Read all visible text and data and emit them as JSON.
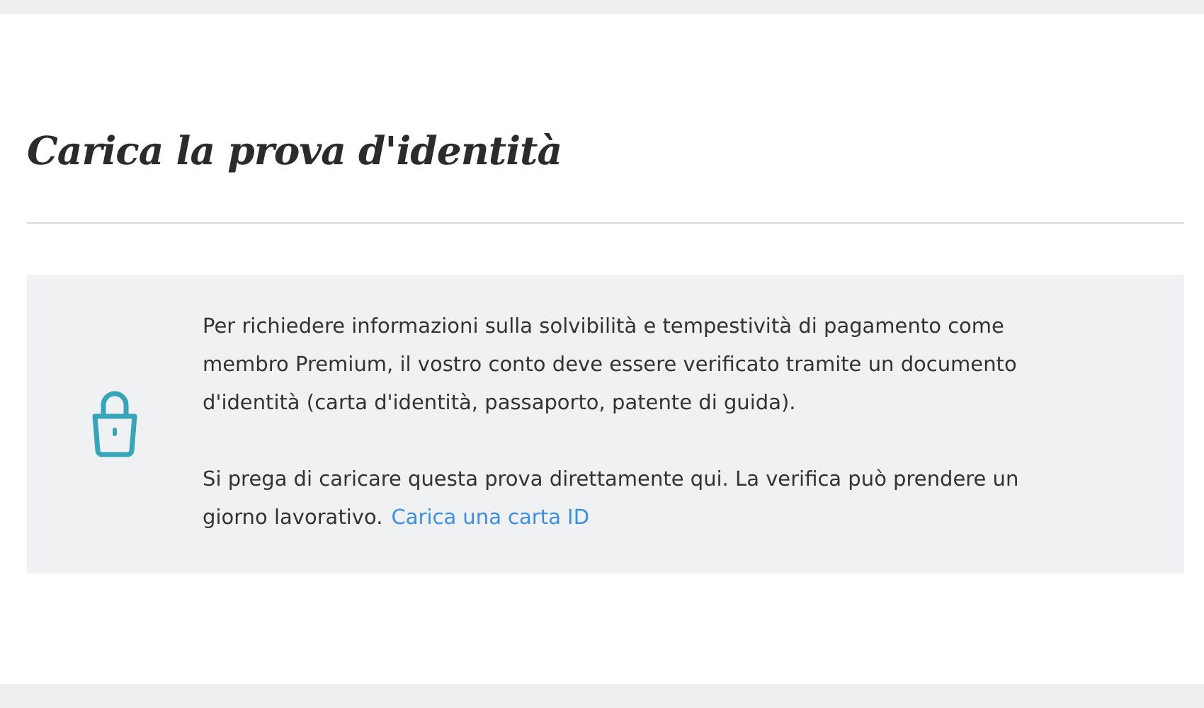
{
  "title": "Carica la prova d'identità",
  "notice": {
    "paragraphs": [
      "Per richiedere informazioni sulla solvibilità e tempestività di pagamento come membro Premium, il vostro conto deve essere verificato tramite un documento d'identità (carta d'identità, passaporto, patente di guida).",
      "Si prega di caricare questa prova direttamente qui. La verifica può prendere un giorno lavorativo."
    ],
    "link": "Carica una carta ID"
  }
}
